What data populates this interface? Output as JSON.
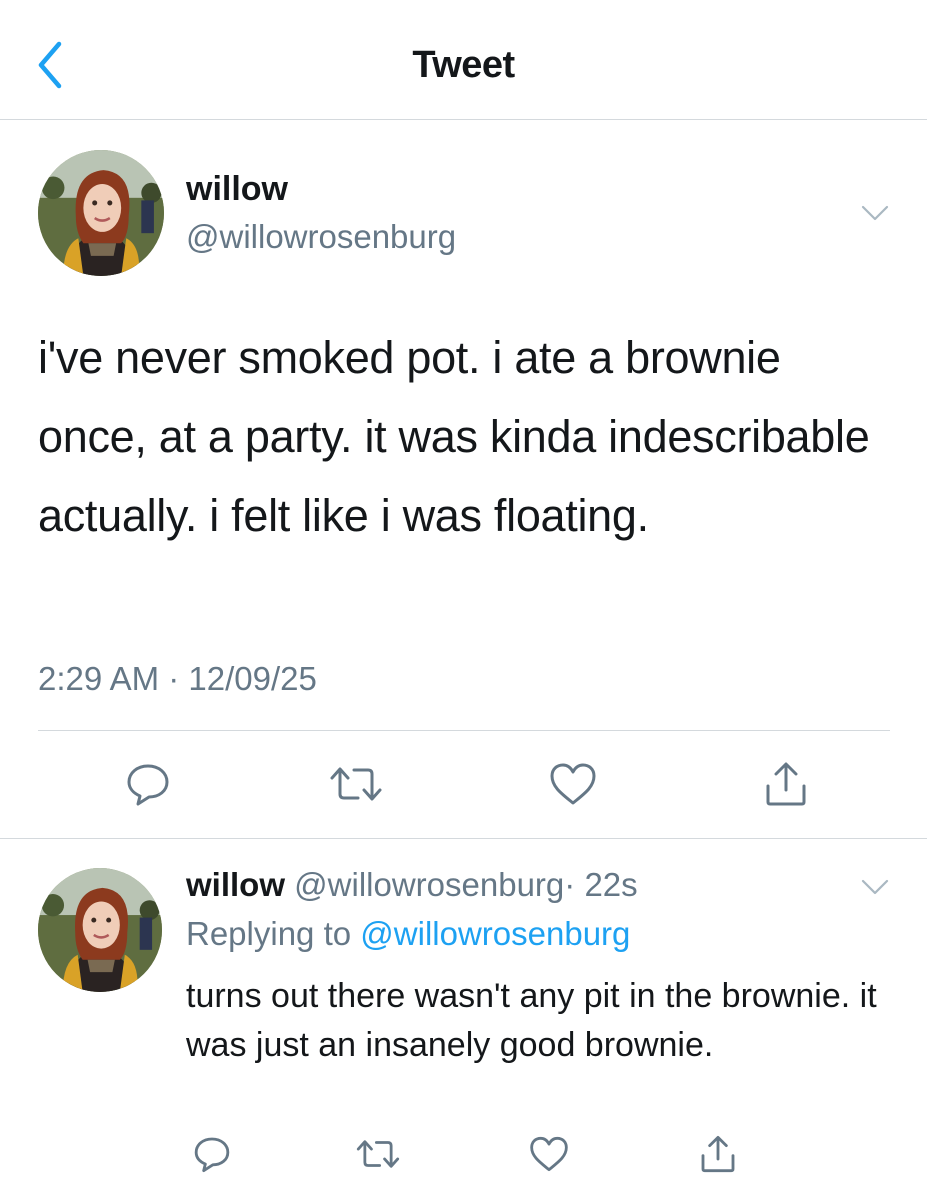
{
  "header": {
    "title": "Tweet",
    "back_icon": "chevron-left-icon"
  },
  "tweet": {
    "author_name": "willow",
    "author_handle": "@willowrosenburg",
    "text": "i've never smoked pot. i ate a brownie once, at a party. it was kinda indescribable actually. i felt like i was floating.",
    "timestamp": "2:29 AM · 12/09/25",
    "actions": [
      "reply-icon",
      "retweet-icon",
      "like-icon",
      "share-icon"
    ]
  },
  "reply": {
    "author_name": "willow",
    "author_handle": "@willowrosenburg",
    "age": "· 22s",
    "replying_prefix": "Replying to",
    "replying_to": "@willowrosenburg",
    "text": "turns out there wasn't any pit in the brownie. it was just an insanely good brownie.",
    "actions": [
      "reply-icon",
      "retweet-icon",
      "like-icon",
      "share-icon"
    ]
  },
  "colors": {
    "accent": "#1da1f2",
    "text": "#14171a",
    "secondary": "#657786",
    "divider": "#d4d9dd"
  }
}
